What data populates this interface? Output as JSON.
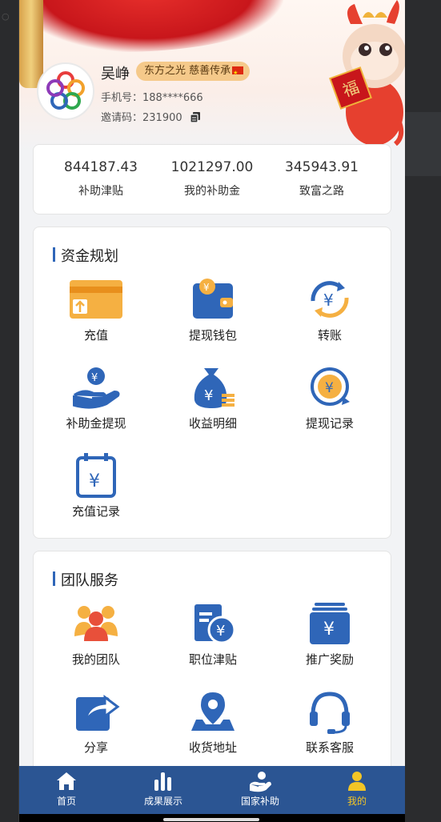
{
  "colors": {
    "accent": "#2f66b8",
    "tabbar": "#2b5593",
    "active_tab": "#f3c526",
    "badge_bg": "#f5c98a"
  },
  "profile": {
    "name": "吴峥",
    "badge": "东方之光  慈善传承",
    "phone_label": "手机号：",
    "phone": "188****666",
    "invite_label": "邀请码：",
    "invite_code": "231900"
  },
  "stats": [
    {
      "value": "844187.43",
      "label": "补助津贴"
    },
    {
      "value": "1021297.00",
      "label": "我的补助金"
    },
    {
      "value": "345943.91",
      "label": "致富之路"
    }
  ],
  "fund_section": {
    "title": "资金规划",
    "items": [
      {
        "label": "充值",
        "icon": "card-icon"
      },
      {
        "label": "提现钱包",
        "icon": "wallet-icon"
      },
      {
        "label": "转账",
        "icon": "transfer-icon"
      },
      {
        "label": "补助金提现",
        "icon": "hand-coin-icon"
      },
      {
        "label": "收益明细",
        "icon": "money-bag-icon"
      },
      {
        "label": "提现记录",
        "icon": "withdraw-record-icon"
      },
      {
        "label": "充值记录",
        "icon": "calendar-yen-icon"
      }
    ]
  },
  "team_section": {
    "title": "团队服务",
    "items": [
      {
        "label": "我的团队",
        "icon": "team-icon"
      },
      {
        "label": "职位津贴",
        "icon": "allowance-icon"
      },
      {
        "label": "推广奖励",
        "icon": "reward-box-icon"
      },
      {
        "label": "分享",
        "icon": "share-icon"
      },
      {
        "label": "收货地址",
        "icon": "location-icon"
      },
      {
        "label": "联系客服",
        "icon": "headset-icon"
      }
    ]
  },
  "tabbar": [
    {
      "label": "首页",
      "icon": "home-icon",
      "active": false
    },
    {
      "label": "成果展示",
      "icon": "bar-chart-icon",
      "active": false
    },
    {
      "label": "国家补助",
      "icon": "subsidy-hand-icon",
      "active": false
    },
    {
      "label": "我的",
      "icon": "user-icon",
      "active": true
    }
  ]
}
